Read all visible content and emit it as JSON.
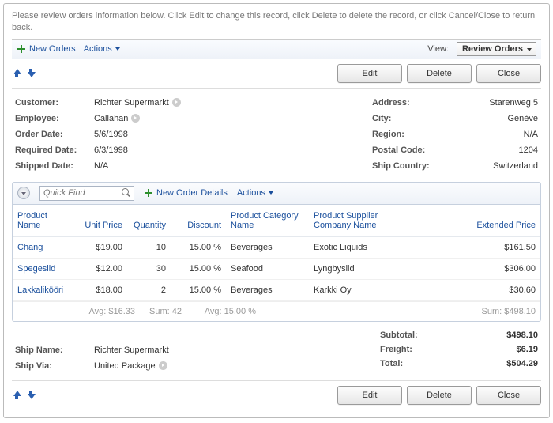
{
  "intro": "Please review orders information below. Click Edit to change this record, click Delete to delete the record, or click Cancel/Close to return back.",
  "toolbar": {
    "new_orders": "New Orders",
    "actions": "Actions",
    "view_label": "View:",
    "view_value": "Review Orders"
  },
  "buttons": {
    "edit": "Edit",
    "delete": "Delete",
    "close": "Close"
  },
  "details": {
    "labels": {
      "customer": "Customer:",
      "employee": "Employee:",
      "order_date": "Order Date:",
      "required_date": "Required Date:",
      "shipped_date": "Shipped Date:",
      "address": "Address:",
      "city": "City:",
      "region": "Region:",
      "postal_code": "Postal Code:",
      "ship_country": "Ship Country:"
    },
    "values": {
      "customer": "Richter Supermarkt",
      "employee": "Callahan",
      "order_date": "5/6/1998",
      "required_date": "6/3/1998",
      "shipped_date": "N/A",
      "address": "Starenweg 5",
      "city": "Genève",
      "region": "N/A",
      "postal_code": "1204",
      "ship_country": "Switzerland"
    }
  },
  "grid": {
    "quick_find_placeholder": "Quick Find",
    "new_details": "New Order Details",
    "actions": "Actions",
    "headers": {
      "product_name": "Product Name",
      "unit_price": "Unit Price",
      "quantity": "Quantity",
      "discount": "Discount",
      "category": "Product Category Name",
      "supplier": "Product Supplier Company Name",
      "extended": "Extended Price"
    },
    "rows": [
      {
        "product": "Chang",
        "unit_price": "$19.00",
        "qty": "10",
        "discount": "15.00 %",
        "category": "Beverages",
        "supplier": "Exotic Liquids",
        "extended": "$161.50"
      },
      {
        "product": "Spegesild",
        "unit_price": "$12.00",
        "qty": "30",
        "discount": "15.00 %",
        "category": "Seafood",
        "supplier": "Lyngbysild",
        "extended": "$306.00"
      },
      {
        "product": "Lakkalikööri",
        "unit_price": "$18.00",
        "qty": "2",
        "discount": "15.00 %",
        "category": "Beverages",
        "supplier": "Karkki Oy",
        "extended": "$30.60"
      }
    ],
    "aggr": {
      "avg_price": "Avg: $16.33",
      "sum_qty": "Sum: 42",
      "avg_disc": "Avg: 15.00 %",
      "sum_ext": "Sum: $498.10"
    }
  },
  "summary": {
    "labels": {
      "subtotal": "Subtotal:",
      "freight": "Freight:",
      "total": "Total:",
      "ship_name": "Ship Name:",
      "ship_via": "Ship Via:"
    },
    "values": {
      "subtotal": "$498.10",
      "freight": "$6.19",
      "total": "$504.29",
      "ship_name": "Richter Supermarkt",
      "ship_via": "United Package"
    }
  }
}
